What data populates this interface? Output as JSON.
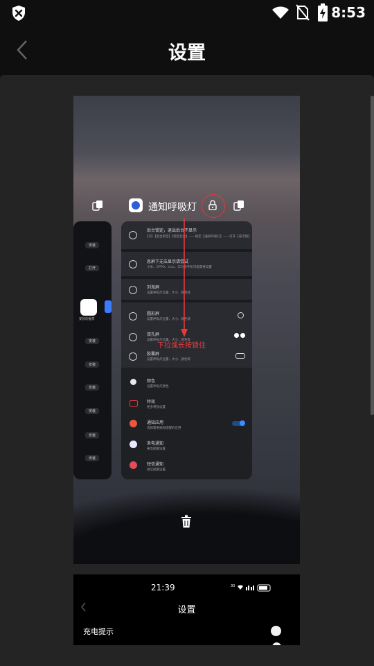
{
  "status_bar": {
    "time": "8:53"
  },
  "app_bar": {
    "title": "设置"
  },
  "screenshot1": {
    "app_label": "通知呼吸灯",
    "annotation": "下拉或长按锁住",
    "left_card": {
      "buttons": [
        "安装",
        "打开",
        "安装",
        "安装",
        "安装",
        "安装",
        "安装",
        "安装"
      ],
      "app_name": "安装的推荐"
    },
    "rows": [
      {
        "title": "后台锁定，退出后台不显示",
        "desc": "打开【后台锁定】【锁定后台】——锁定【通知呼吸灯】——打开【悬浮窗】"
      },
      {
        "title": "息屏下无法显示请尝试",
        "desc": "小米、OPPO、vivo、华为等手机可能需要设置"
      },
      {
        "title": "刘海屏",
        "desc": "设置呼吸灯位置、大小、颜色等"
      },
      {
        "title": "圆形屏",
        "desc": "设置呼吸灯位置、大小、颜色等"
      },
      {
        "title": "双孔屏",
        "desc": "设置呼吸灯位置、大小、颜色等"
      },
      {
        "title": "胶囊屏",
        "desc": "设置呼吸灯位置、大小、颜色等"
      },
      {
        "title": "颜色",
        "desc": "设置呼吸灯颜色"
      },
      {
        "title": "特效",
        "desc": "更多特效设置"
      },
      {
        "title": "通知应用",
        "desc": "选择需要通知提醒的应用"
      },
      {
        "title": "来电通知",
        "desc": "来电提醒设置"
      },
      {
        "title": "短信通知",
        "desc": "短信提醒设置"
      }
    ]
  },
  "screenshot2": {
    "time": "21:39",
    "title": "设置",
    "row_label": "充电提示"
  },
  "colors": {
    "accent_red": "#e23a3a",
    "toggle_blue": "#3a8dff"
  }
}
